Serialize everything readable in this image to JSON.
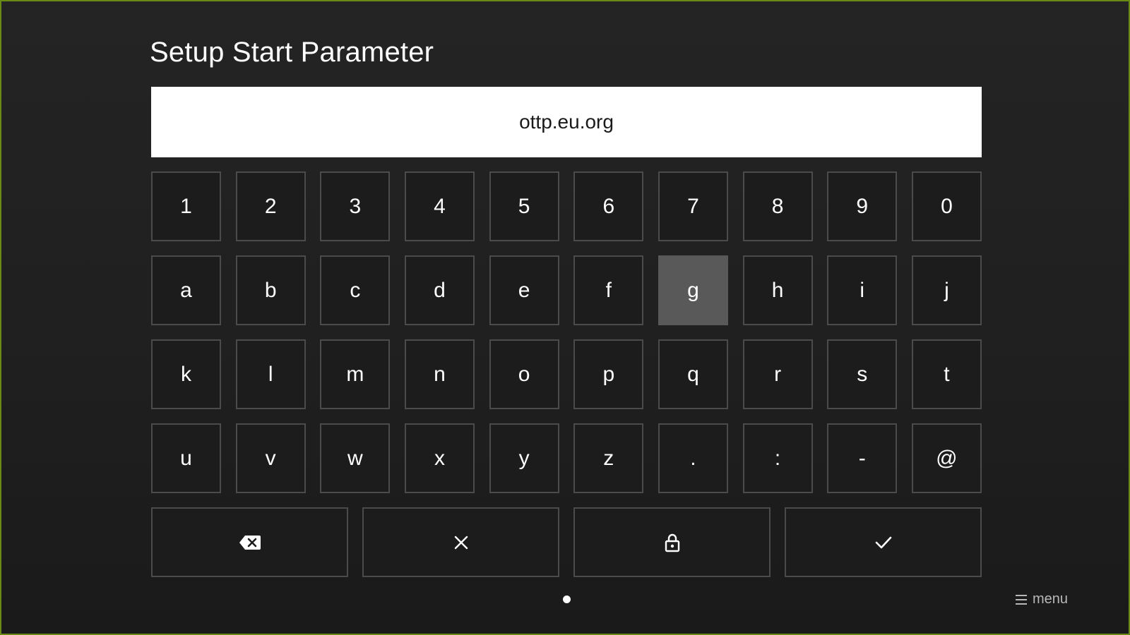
{
  "title": "Setup Start Parameter",
  "input": {
    "value": "ottp.eu.org"
  },
  "keyboard": {
    "rows": [
      [
        "1",
        "2",
        "3",
        "4",
        "5",
        "6",
        "7",
        "8",
        "9",
        "0"
      ],
      [
        "a",
        "b",
        "c",
        "d",
        "e",
        "f",
        "g",
        "h",
        "i",
        "j"
      ],
      [
        "k",
        "l",
        "m",
        "n",
        "o",
        "p",
        "q",
        "r",
        "s",
        "t"
      ],
      [
        "u",
        "v",
        "w",
        "x",
        "y",
        "z",
        ".",
        ":",
        "-",
        "@"
      ]
    ],
    "focused_key": "g",
    "actions": [
      {
        "name": "backspace",
        "icon": "backspace-icon"
      },
      {
        "name": "clear",
        "icon": "close-icon"
      },
      {
        "name": "lock",
        "icon": "lock-icon"
      },
      {
        "name": "confirm",
        "icon": "check-icon"
      }
    ]
  },
  "footer": {
    "page_indicator": "page-dot",
    "menu_label": "menu",
    "menu_icon": "menu-icon"
  },
  "colors": {
    "background": "#222222",
    "key_border": "#4b4b4b",
    "key_focus": "#595959",
    "input_background": "#ffffff",
    "frame_border": "#6a8a18"
  }
}
